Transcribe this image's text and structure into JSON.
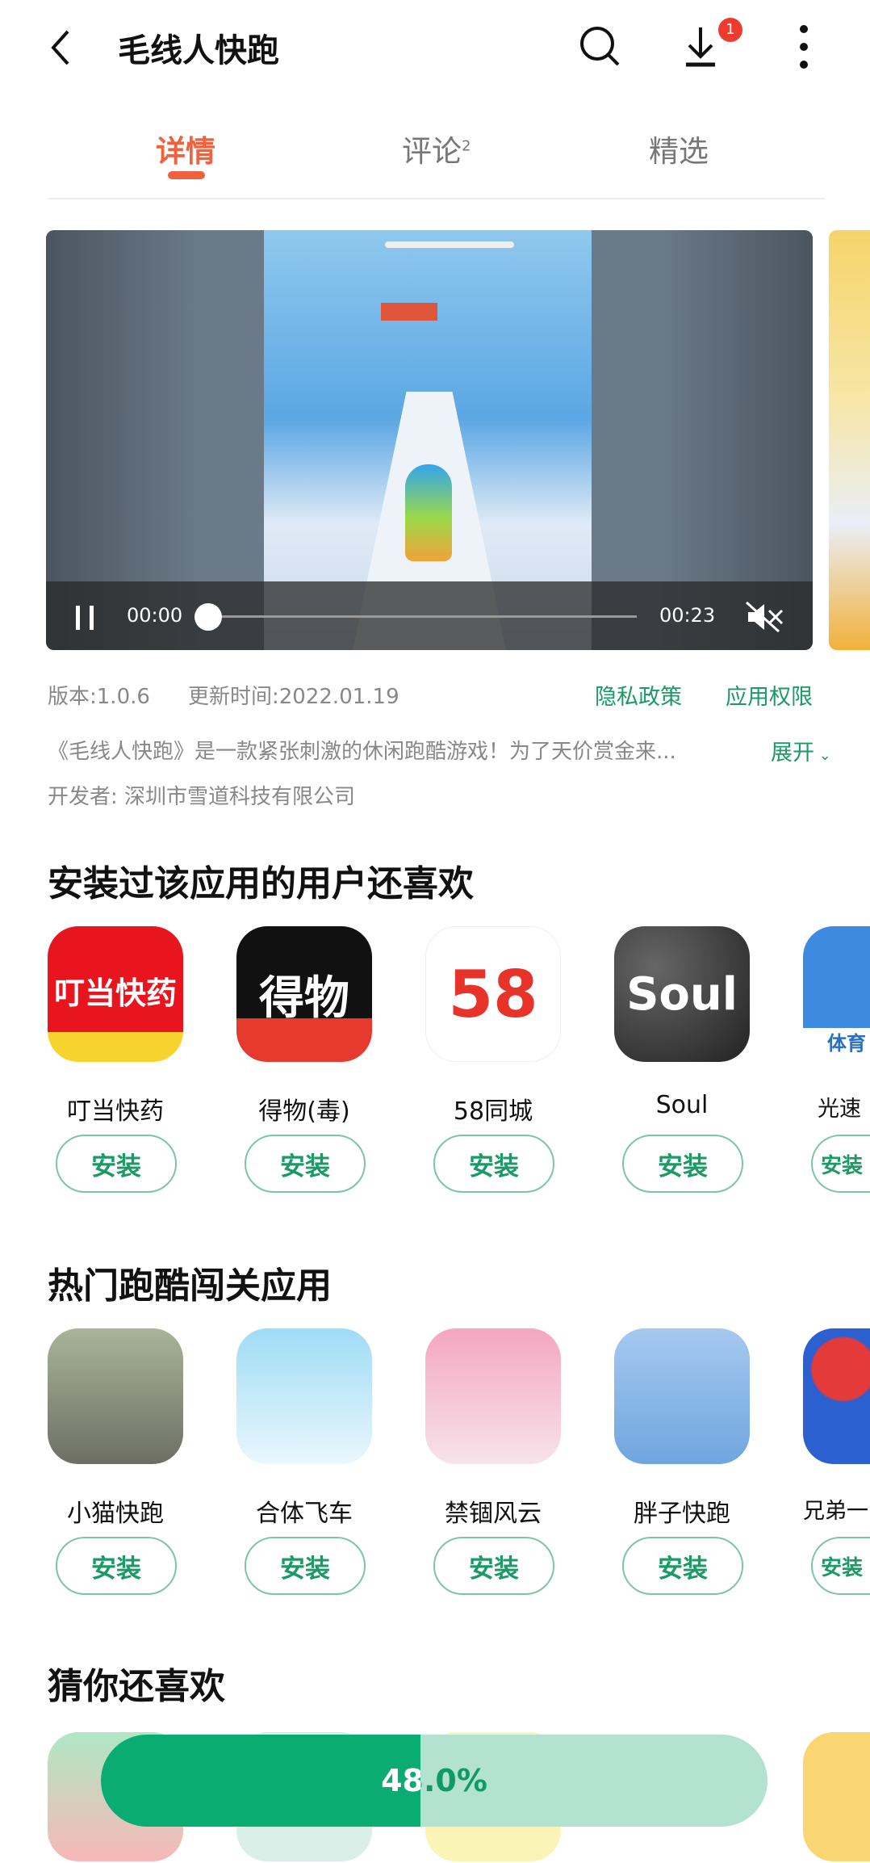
{
  "header": {
    "title": "毛线人快跑",
    "download_badge": "1",
    "icons": [
      "back-icon",
      "search-icon",
      "download-icon",
      "more-icon"
    ]
  },
  "tabs": [
    {
      "label": "详情",
      "active": true
    },
    {
      "label": "评论",
      "count": "2"
    },
    {
      "label": "精选"
    }
  ],
  "video": {
    "current_time": "00:00",
    "duration": "00:23",
    "playing": true,
    "muted": true,
    "progress": 0
  },
  "info": {
    "version": "版本:1.0.6",
    "updated": "更新时间:2022.01.19",
    "privacy": "隐私政策",
    "permissions": "应用权限",
    "description": "《毛线人快跑》是一款紧张刺激的休闲跑酷游戏！为了天价赏金来...",
    "expand": "展开",
    "developer": "开发者: 深圳市雪道科技有限公司"
  },
  "sections": [
    {
      "title": "安装过该应用的用户还喜欢",
      "apps": [
        {
          "name": "叮当快药",
          "icon_text": "叮当快药",
          "color": "#e8141e"
        },
        {
          "name": "得物(毒)",
          "icon_text": "得物",
          "color": "#111111"
        },
        {
          "name": "58同城",
          "icon_text": "58",
          "color": "#ffffff"
        },
        {
          "name": "Soul",
          "icon_text": "Soul",
          "color": "#2a2a2a"
        },
        {
          "name": "光速",
          "icon_text": "体育",
          "color": "#3d8ae0"
        }
      ]
    },
    {
      "title": "热门跑酷闯关应用",
      "apps": [
        {
          "name": "小猫快跑",
          "color": "#8a8f7a"
        },
        {
          "name": "合体飞车",
          "color": "#bfe6f7"
        },
        {
          "name": "禁锢风云",
          "color": "#f4a7c0"
        },
        {
          "name": "胖子快跑",
          "color": "#8fb8e8"
        },
        {
          "name": "兄弟一",
          "color": "#2c5fd0"
        }
      ]
    }
  ],
  "section3": {
    "title": "猜你还喜欢"
  },
  "install_label": "安装",
  "download_progress": {
    "percent": 48.0,
    "label": "48.0%"
  },
  "colors": {
    "accent_tab": "#f0623e",
    "green": "#1c9a66",
    "progress_fill": "#0bac72",
    "progress_track": "#b3e3d0"
  }
}
